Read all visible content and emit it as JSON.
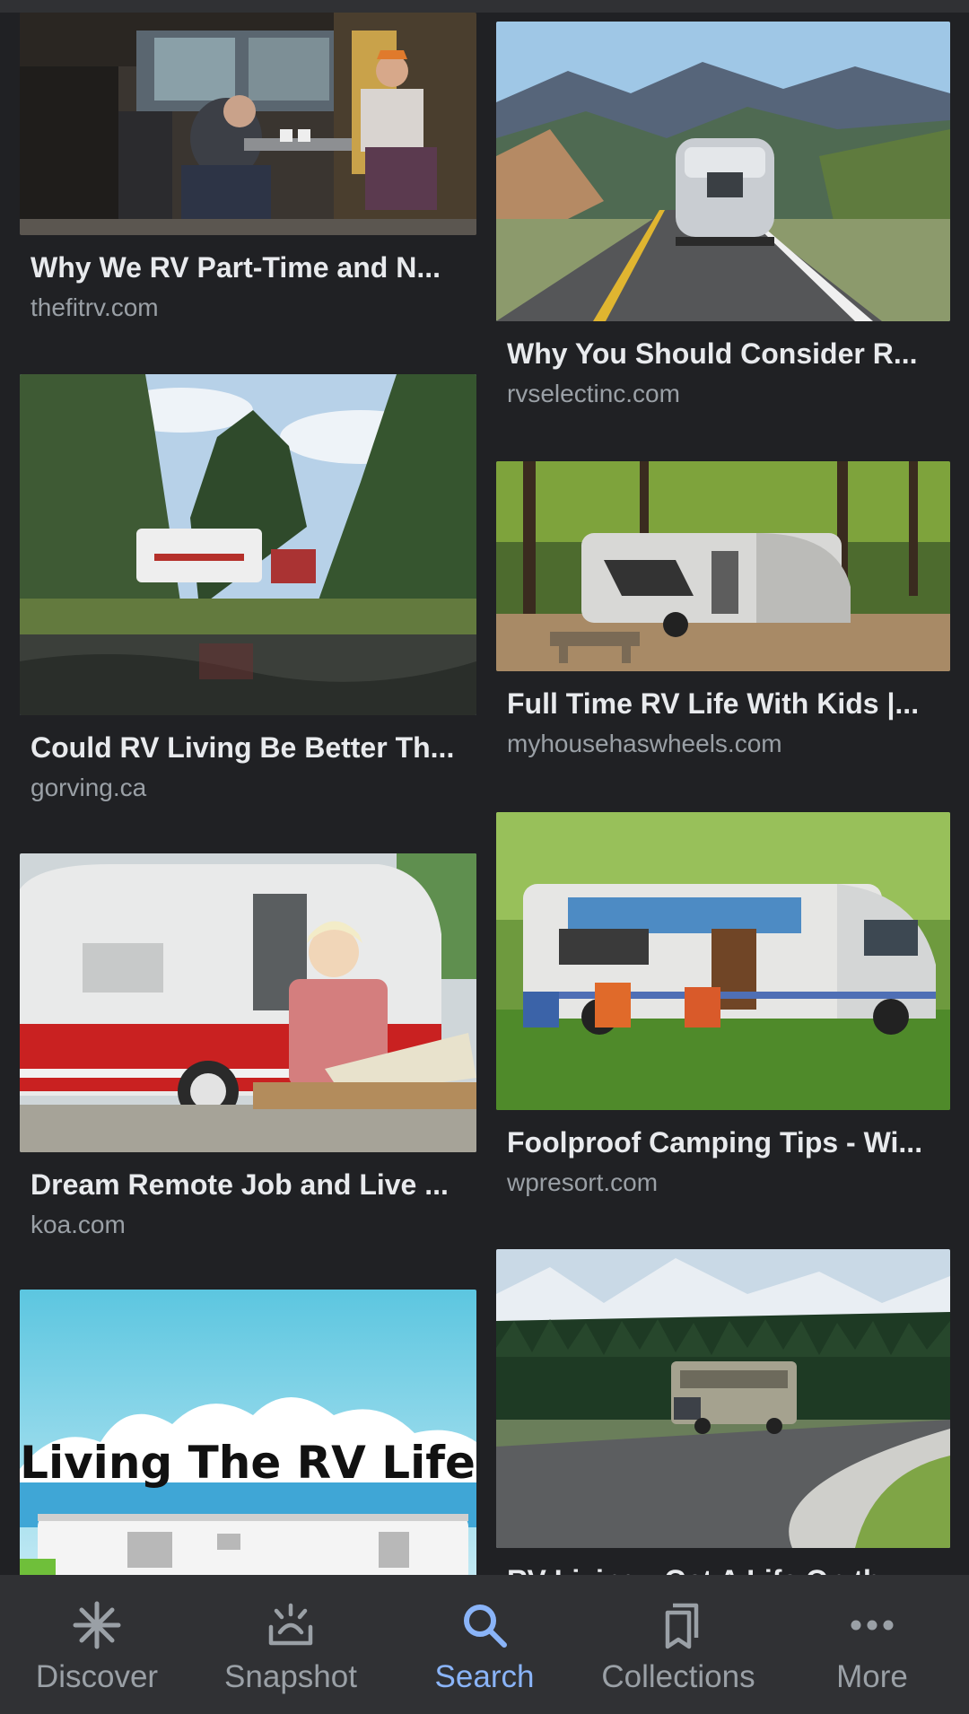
{
  "results": [
    {
      "title": "Why We RV Part-Time and N...",
      "source": "thefitrv.com"
    },
    {
      "title": "Why You Should Consider R...",
      "source": "rvselectinc.com"
    },
    {
      "title": "Could RV Living Be Better Th...",
      "source": "gorving.ca"
    },
    {
      "title": "Full Time RV Life With Kids |...",
      "source": "myhousehaswheels.com"
    },
    {
      "title": "Dream Remote Job and Live ...",
      "source": "koa.com"
    },
    {
      "title": "Foolproof Camping Tips - Wi...",
      "source": "wpresort.com"
    },
    {
      "title": "",
      "source": "",
      "image_text": "Living The RV Life"
    },
    {
      "title": "RV Living - Get A Life On th...",
      "source": ""
    }
  ],
  "nav": {
    "items": [
      {
        "label": "Discover",
        "icon": "asterisk-icon"
      },
      {
        "label": "Snapshot",
        "icon": "snapshot-icon"
      },
      {
        "label": "Search",
        "icon": "search-icon"
      },
      {
        "label": "Collections",
        "icon": "collections-icon"
      },
      {
        "label": "More",
        "icon": "more-dots-icon"
      }
    ],
    "active": "Search"
  },
  "colors": {
    "background": "#202124",
    "nav_background": "#303134",
    "accent": "#8ab4f8",
    "muted": "#9aa0a6"
  }
}
